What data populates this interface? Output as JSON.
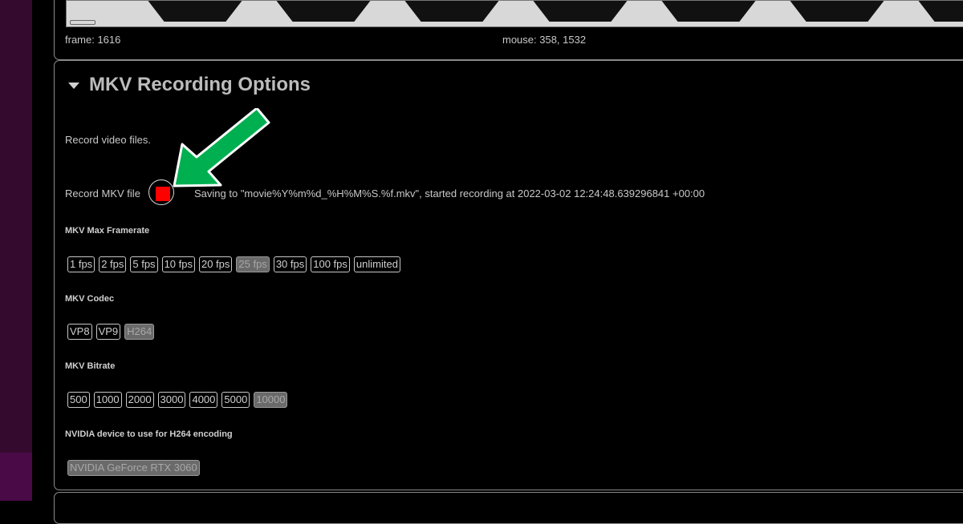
{
  "video": {
    "frame_text": "frame: 1616",
    "mouse_text": "mouse: 358, 1532"
  },
  "section": {
    "title": "MKV Recording Options",
    "description": "Record video files.",
    "record_label": "Record MKV file",
    "record_status": "Saving to \"movie%Y%m%d_%H%M%S.%f.mkv\", started recording at 2022-03-02 12:24:48.639296841 +00:00"
  },
  "framerate": {
    "label": "MKV Max Framerate",
    "options": [
      "1 fps",
      "2 fps",
      "5 fps",
      "10 fps",
      "20 fps",
      "25 fps",
      "30 fps",
      "100 fps",
      "unlimited"
    ],
    "selected": "25 fps"
  },
  "codec": {
    "label": "MKV Codec",
    "options": [
      "VP8",
      "VP9",
      "H264"
    ],
    "selected": "H264"
  },
  "bitrate": {
    "label": "MKV Bitrate",
    "options": [
      "500",
      "1000",
      "2000",
      "3000",
      "4000",
      "5000",
      "10000"
    ],
    "selected": "10000"
  },
  "nvidia": {
    "label": "NVIDIA device to use for H264 encoding",
    "options": [
      "NVIDIA GeForce RTX 3060"
    ],
    "selected": "NVIDIA GeForce RTX 3060"
  },
  "colors": {
    "record_red": "#ff0000",
    "arrow_green": "#00b050",
    "selected_button": "#6a6a6a",
    "sidebar": "#350a2f"
  },
  "icons": {
    "collapse": "triangle-down-icon",
    "record": "record-stop-icon",
    "annotation": "green-arrow-icon"
  }
}
